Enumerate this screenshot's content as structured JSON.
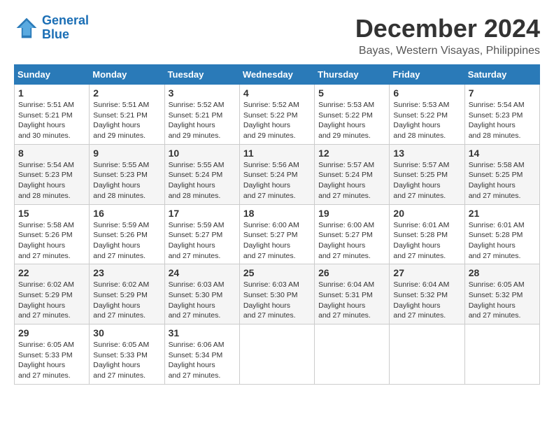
{
  "logo": {
    "line1": "General",
    "line2": "Blue"
  },
  "title": "December 2024",
  "location": "Bayas, Western Visayas, Philippines",
  "weekdays": [
    "Sunday",
    "Monday",
    "Tuesday",
    "Wednesday",
    "Thursday",
    "Friday",
    "Saturday"
  ],
  "weeks": [
    [
      {
        "day": "1",
        "sunrise": "5:51 AM",
        "sunset": "5:21 PM",
        "daylight": "11 hours and 30 minutes."
      },
      {
        "day": "2",
        "sunrise": "5:51 AM",
        "sunset": "5:21 PM",
        "daylight": "11 hours and 29 minutes."
      },
      {
        "day": "3",
        "sunrise": "5:52 AM",
        "sunset": "5:21 PM",
        "daylight": "11 hours and 29 minutes."
      },
      {
        "day": "4",
        "sunrise": "5:52 AM",
        "sunset": "5:22 PM",
        "daylight": "11 hours and 29 minutes."
      },
      {
        "day": "5",
        "sunrise": "5:53 AM",
        "sunset": "5:22 PM",
        "daylight": "11 hours and 29 minutes."
      },
      {
        "day": "6",
        "sunrise": "5:53 AM",
        "sunset": "5:22 PM",
        "daylight": "11 hours and 28 minutes."
      },
      {
        "day": "7",
        "sunrise": "5:54 AM",
        "sunset": "5:23 PM",
        "daylight": "11 hours and 28 minutes."
      }
    ],
    [
      {
        "day": "8",
        "sunrise": "5:54 AM",
        "sunset": "5:23 PM",
        "daylight": "11 hours and 28 minutes."
      },
      {
        "day": "9",
        "sunrise": "5:55 AM",
        "sunset": "5:23 PM",
        "daylight": "11 hours and 28 minutes."
      },
      {
        "day": "10",
        "sunrise": "5:55 AM",
        "sunset": "5:24 PM",
        "daylight": "11 hours and 28 minutes."
      },
      {
        "day": "11",
        "sunrise": "5:56 AM",
        "sunset": "5:24 PM",
        "daylight": "11 hours and 27 minutes."
      },
      {
        "day": "12",
        "sunrise": "5:57 AM",
        "sunset": "5:24 PM",
        "daylight": "11 hours and 27 minutes."
      },
      {
        "day": "13",
        "sunrise": "5:57 AM",
        "sunset": "5:25 PM",
        "daylight": "11 hours and 27 minutes."
      },
      {
        "day": "14",
        "sunrise": "5:58 AM",
        "sunset": "5:25 PM",
        "daylight": "11 hours and 27 minutes."
      }
    ],
    [
      {
        "day": "15",
        "sunrise": "5:58 AM",
        "sunset": "5:26 PM",
        "daylight": "11 hours and 27 minutes."
      },
      {
        "day": "16",
        "sunrise": "5:59 AM",
        "sunset": "5:26 PM",
        "daylight": "11 hours and 27 minutes."
      },
      {
        "day": "17",
        "sunrise": "5:59 AM",
        "sunset": "5:27 PM",
        "daylight": "11 hours and 27 minutes."
      },
      {
        "day": "18",
        "sunrise": "6:00 AM",
        "sunset": "5:27 PM",
        "daylight": "11 hours and 27 minutes."
      },
      {
        "day": "19",
        "sunrise": "6:00 AM",
        "sunset": "5:27 PM",
        "daylight": "11 hours and 27 minutes."
      },
      {
        "day": "20",
        "sunrise": "6:01 AM",
        "sunset": "5:28 PM",
        "daylight": "11 hours and 27 minutes."
      },
      {
        "day": "21",
        "sunrise": "6:01 AM",
        "sunset": "5:28 PM",
        "daylight": "11 hours and 27 minutes."
      }
    ],
    [
      {
        "day": "22",
        "sunrise": "6:02 AM",
        "sunset": "5:29 PM",
        "daylight": "11 hours and 27 minutes."
      },
      {
        "day": "23",
        "sunrise": "6:02 AM",
        "sunset": "5:29 PM",
        "daylight": "11 hours and 27 minutes."
      },
      {
        "day": "24",
        "sunrise": "6:03 AM",
        "sunset": "5:30 PM",
        "daylight": "11 hours and 27 minutes."
      },
      {
        "day": "25",
        "sunrise": "6:03 AM",
        "sunset": "5:30 PM",
        "daylight": "11 hours and 27 minutes."
      },
      {
        "day": "26",
        "sunrise": "6:04 AM",
        "sunset": "5:31 PM",
        "daylight": "11 hours and 27 minutes."
      },
      {
        "day": "27",
        "sunrise": "6:04 AM",
        "sunset": "5:32 PM",
        "daylight": "11 hours and 27 minutes."
      },
      {
        "day": "28",
        "sunrise": "6:05 AM",
        "sunset": "5:32 PM",
        "daylight": "11 hours and 27 minutes."
      }
    ],
    [
      {
        "day": "29",
        "sunrise": "6:05 AM",
        "sunset": "5:33 PM",
        "daylight": "11 hours and 27 minutes."
      },
      {
        "day": "30",
        "sunrise": "6:05 AM",
        "sunset": "5:33 PM",
        "daylight": "11 hours and 27 minutes."
      },
      {
        "day": "31",
        "sunrise": "6:06 AM",
        "sunset": "5:34 PM",
        "daylight": "11 hours and 27 minutes."
      },
      null,
      null,
      null,
      null
    ]
  ]
}
